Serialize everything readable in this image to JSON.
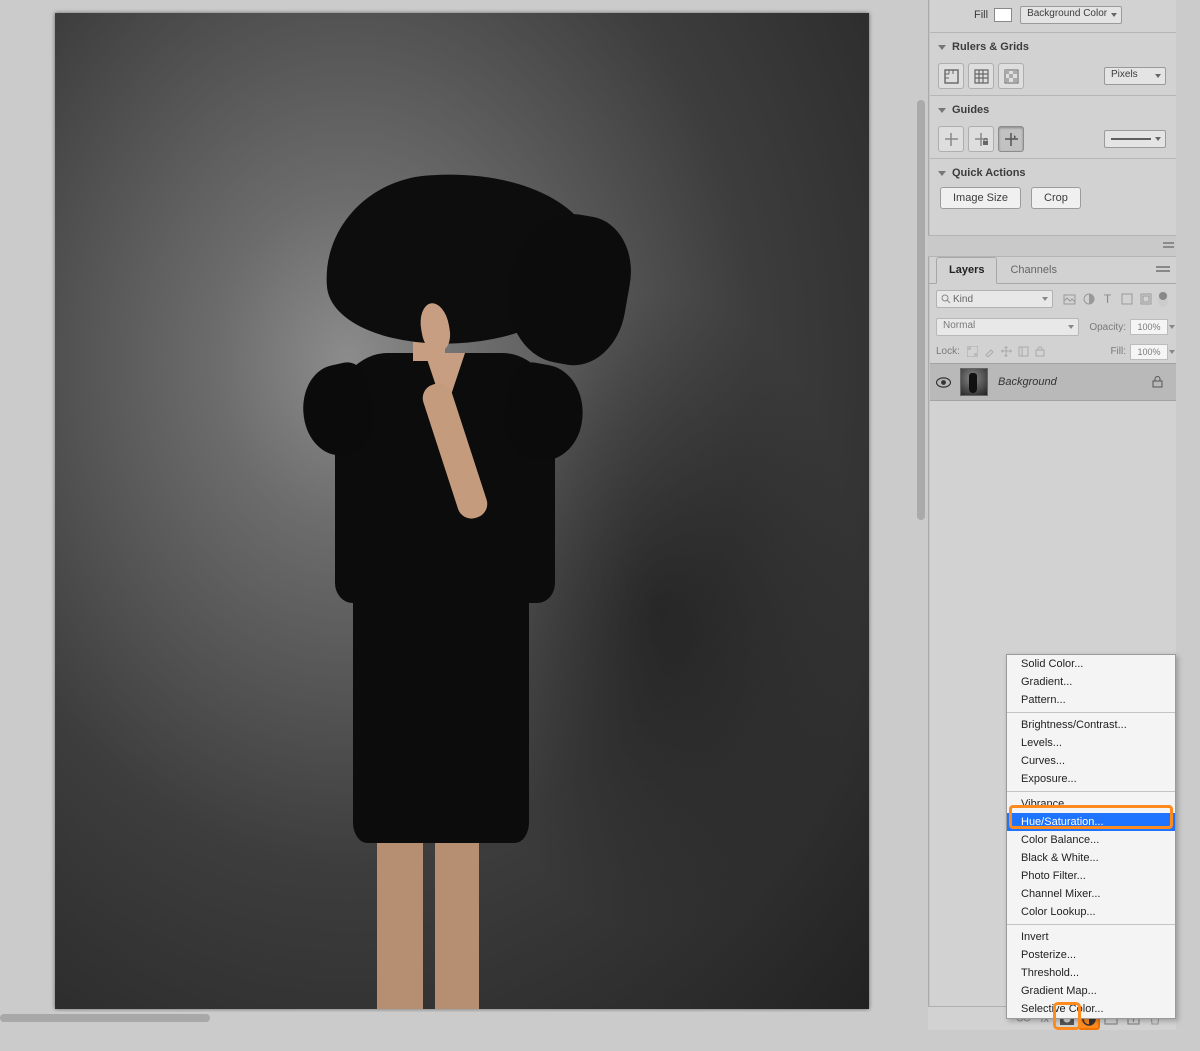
{
  "fill": {
    "label": "Fill",
    "swatch_color": "#ffffff",
    "mode": "Background Color"
  },
  "rulers_grids": {
    "title": "Rulers & Grids",
    "units": "Pixels",
    "icons": [
      "ruler",
      "grid",
      "transparency"
    ]
  },
  "guides": {
    "title": "Guides",
    "line_style": "———",
    "icons": [
      "new-guide",
      "lock-guides",
      "smart-guides"
    ]
  },
  "quick_actions": {
    "title": "Quick Actions",
    "image_size": "Image Size",
    "crop": "Crop"
  },
  "layers_panel": {
    "tabs": {
      "layers": "Layers",
      "channels": "Channels"
    },
    "filter_kind": "Kind",
    "blend_mode": "Normal",
    "opacity_label": "Opacity:",
    "opacity_value": "100%",
    "lock_label": "Lock:",
    "fill_label": "Fill:",
    "fill_value": "100%",
    "layers": [
      {
        "name": "Background",
        "visible": true,
        "locked": true
      }
    ],
    "footer_icons": [
      "link",
      "fx",
      "mask",
      "adjustment",
      "group",
      "new",
      "trash"
    ]
  },
  "adjustment_menu": {
    "groups": [
      [
        "Solid Color...",
        "Gradient...",
        "Pattern..."
      ],
      [
        "Brightness/Contrast...",
        "Levels...",
        "Curves...",
        "Exposure..."
      ],
      [
        "Vibrance...",
        "Hue/Saturation...",
        "Color Balance...",
        "Black & White...",
        "Photo Filter...",
        "Channel Mixer...",
        "Color Lookup..."
      ],
      [
        "Invert",
        "Posterize...",
        "Threshold...",
        "Gradient Map...",
        "Selective Color..."
      ]
    ],
    "selected": "Hue/Saturation..."
  }
}
